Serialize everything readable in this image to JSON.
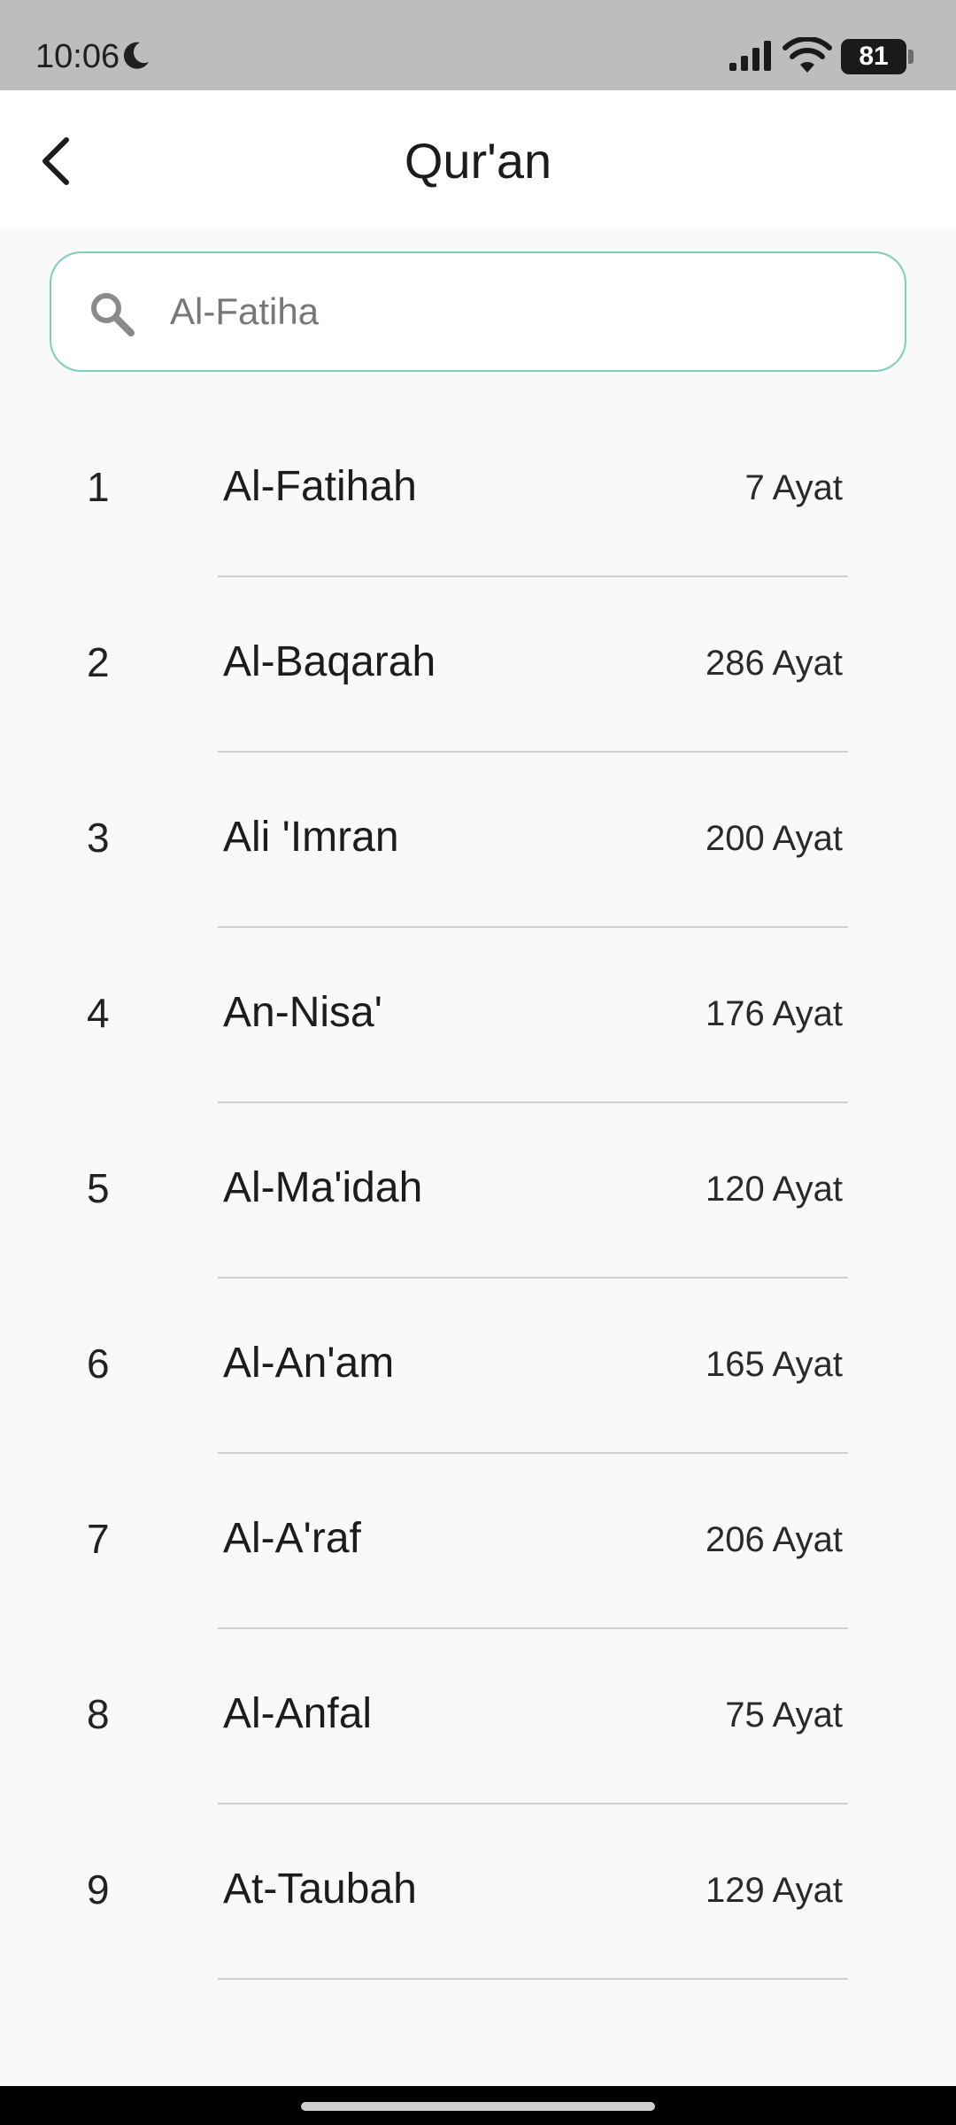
{
  "status_bar": {
    "time": "10:06",
    "battery": "81"
  },
  "header": {
    "title": "Qur'an"
  },
  "search": {
    "placeholder": "Al-Fatiha"
  },
  "surahs": [
    {
      "number": "1",
      "name": "Al-Fatihah",
      "ayat": "7 Ayat"
    },
    {
      "number": "2",
      "name": "Al-Baqarah",
      "ayat": "286 Ayat"
    },
    {
      "number": "3",
      "name": "Ali 'Imran",
      "ayat": "200 Ayat"
    },
    {
      "number": "4",
      "name": "An-Nisa'",
      "ayat": "176 Ayat"
    },
    {
      "number": "5",
      "name": "Al-Ma'idah",
      "ayat": "120 Ayat"
    },
    {
      "number": "6",
      "name": "Al-An'am",
      "ayat": "165 Ayat"
    },
    {
      "number": "7",
      "name": "Al-A'raf",
      "ayat": "206 Ayat"
    },
    {
      "number": "8",
      "name": "Al-Anfal",
      "ayat": "75 Ayat"
    },
    {
      "number": "9",
      "name": "At-Taubah",
      "ayat": "129 Ayat"
    }
  ],
  "icons": {
    "back": "chevron-left-icon",
    "search": "search-icon",
    "moon": "moon-icon",
    "signal": "signal-icon",
    "wifi": "wifi-icon"
  },
  "colors": {
    "search_border": "#7ccfb8",
    "status_bar_bg": "#bdbdbd",
    "page_bg": "#f9f9f9"
  }
}
